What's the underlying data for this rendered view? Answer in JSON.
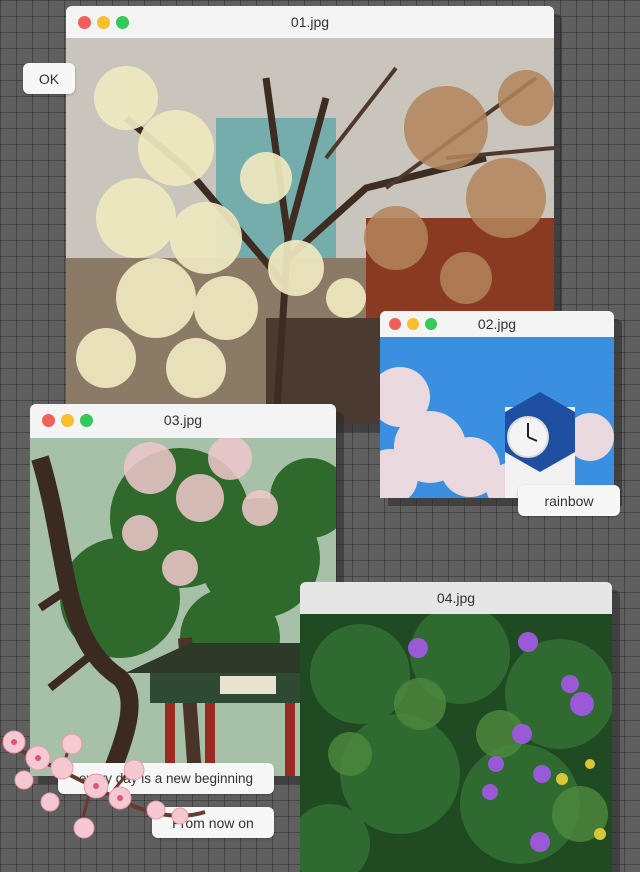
{
  "windows": {
    "w1": {
      "title": "01.jpg"
    },
    "w2": {
      "title": "02.jpg"
    },
    "w3": {
      "title": "03.jpg"
    },
    "w4": {
      "title": "04.jpg"
    }
  },
  "labels": {
    "ok": "OK",
    "rainbow": "rainbow",
    "new_beginning": "every day is a new beginning",
    "from_now_on": "From now on"
  },
  "colors": {
    "dot_close": "#f25f58",
    "dot_minimize": "#f8be2c",
    "dot_zoom": "#35c85a"
  }
}
